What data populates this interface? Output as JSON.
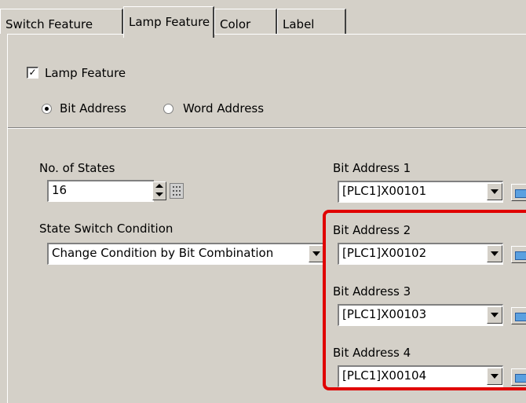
{
  "tabs": [
    {
      "label": "Switch Feature"
    },
    {
      "label": "Lamp Feature"
    },
    {
      "label": "Color"
    },
    {
      "label": "Label"
    }
  ],
  "lamp_feature": {
    "label": "Lamp Feature",
    "checked": true
  },
  "address_mode": {
    "options": [
      {
        "label": "Bit Address",
        "selected": true
      },
      {
        "label": "Word Address",
        "selected": false
      }
    ]
  },
  "states": {
    "label": "No. of States",
    "value": "16"
  },
  "state_switch": {
    "label": "State Switch Condition",
    "value": "Change Condition by Bit Combination"
  },
  "bit_addresses": [
    {
      "label": "Bit Address 1",
      "value": "[PLC1]X00101"
    },
    {
      "label": "Bit Address 2",
      "value": "[PLC1]X00102"
    },
    {
      "label": "Bit Address 3",
      "value": "[PLC1]X00103"
    },
    {
      "label": "Bit Address 4",
      "value": "[PLC1]X00104"
    }
  ],
  "colors": {
    "highlight": "#e00000",
    "background": "#d4d0c8"
  }
}
